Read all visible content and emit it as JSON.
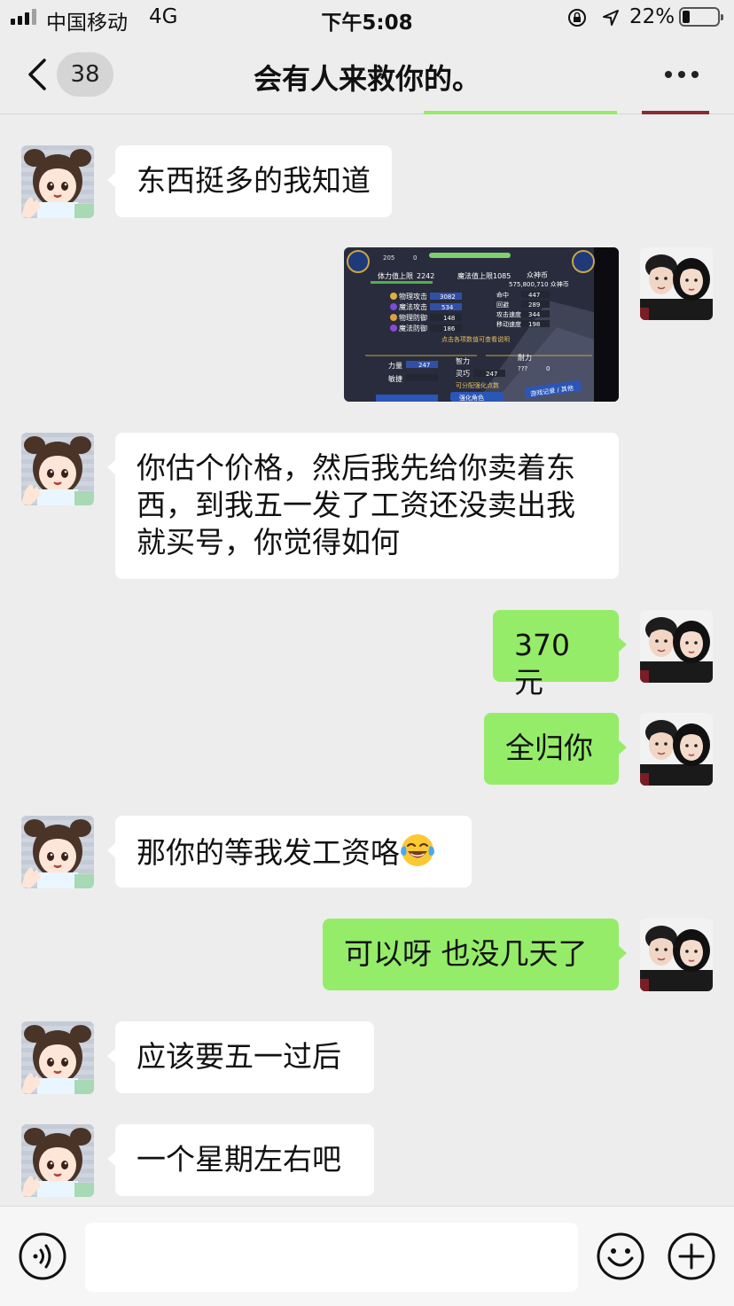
{
  "status_bar": {
    "carrier": "中国移动",
    "network": "4G",
    "time": "下午5:08",
    "battery_percent": "22%",
    "battery_level": 0.22
  },
  "nav": {
    "unread_count": "38",
    "title": "会有人来救你的。"
  },
  "messages": [
    {
      "side": "in",
      "type": "text",
      "text": "东西挺多的我知道"
    },
    {
      "side": "out",
      "type": "image",
      "game_screenshot": {
        "hp_label": "体力值上限",
        "hp_value": "2242",
        "mp_label": "魔法值上限",
        "mp_value": "1085",
        "currency_label": "众神币",
        "currency_value": "575,800,710 众神币",
        "stats": [
          {
            "label": "物理攻击",
            "value": "3082"
          },
          {
            "label": "魔法攻击",
            "value": "534"
          },
          {
            "label": "物理防御",
            "value": "148"
          },
          {
            "label": "魔法防御",
            "value": "186"
          }
        ],
        "stats_right": [
          {
            "label": "命中",
            "value": "447"
          },
          {
            "label": "回避",
            "value": "289"
          },
          {
            "label": "攻击速度",
            "value": "344"
          },
          {
            "label": "移动速度",
            "value": "198"
          }
        ],
        "hint": "点击各项数值可查看说明",
        "attrs": [
          {
            "label": "力量",
            "value": "247"
          },
          {
            "label": "智力",
            "value": ""
          },
          {
            "label": "耐力",
            "value": ""
          },
          {
            "label": "敏捷",
            "value": ""
          },
          {
            "label": "灵巧",
            "value": "247"
          },
          {
            "label": "???",
            "value": "0"
          }
        ],
        "points_label": "可分配强化点数",
        "button_enhance": "强化角色",
        "button_log": "游戏记录 / 其他",
        "level": "205",
        "zero": "0"
      }
    },
    {
      "side": "in",
      "type": "text",
      "text": "你估个价格，然后我先给你卖着东\n西，到我五一发了工资还没卖出我\n就买号，你觉得如何"
    },
    {
      "side": "out",
      "type": "text",
      "text": "370元"
    },
    {
      "side": "out",
      "type": "text",
      "text": "全归你"
    },
    {
      "side": "in",
      "type": "text",
      "text": "那你的等我发工资咯"
    },
    {
      "side": "out",
      "type": "text",
      "text": "可以呀 也没几天了"
    },
    {
      "side": "in",
      "type": "text",
      "text": "应该要五一过后"
    },
    {
      "side": "in",
      "type": "text",
      "text": "一个星期左右吧"
    }
  ],
  "icons": {
    "back": "chevron-left-icon",
    "more": "more-dots-icon",
    "voice": "voice-icon",
    "emoji": "emoji-icon",
    "plus": "plus-icon",
    "laugh_emoji": "tears-of-joy-emoji"
  },
  "colors": {
    "background": "#ededed",
    "incoming_bubble": "#ffffff",
    "outgoing_bubble": "#95ec69"
  }
}
